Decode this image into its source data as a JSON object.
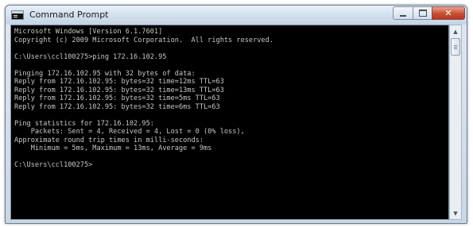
{
  "window": {
    "title": "Command Prompt",
    "icon": "cmd-icon",
    "controls": {
      "minimize": "minimize-icon",
      "maximize": "maximize-icon",
      "close_label": "✕"
    }
  },
  "console": {
    "lines": [
      "Microsoft Windows [Version 6.1.7601]",
      "Copyright (c) 2009 Microsoft Corporation.  All rights reserved.",
      "",
      "C:\\Users\\ccl100275>ping 172.16.102.95",
      "",
      "Pinging 172.16.102.95 with 32 bytes of data:",
      "Reply from 172.16.102.95: bytes=32 time=12ms TTL=63",
      "Reply from 172.16.102.95: bytes=32 time=13ms TTL=63",
      "Reply from 172.16.102.95: bytes=32 time=5ms TTL=63",
      "Reply from 172.16.102.95: bytes=32 time=6ms TTL=63",
      "",
      "Ping statistics for 172.16.102.95:",
      "    Packets: Sent = 4, Received = 4, Lost = 0 (0% loss),",
      "Approximate round trip times in milli-seconds:",
      "    Minimum = 5ms, Maximum = 13ms, Average = 9ms",
      "",
      "C:\\Users\\ccl100275>"
    ],
    "text_color": "#c7c7c7",
    "background": "#000000"
  },
  "scrollbar": {
    "up_arrow": "▲",
    "down_arrow": "▼"
  }
}
